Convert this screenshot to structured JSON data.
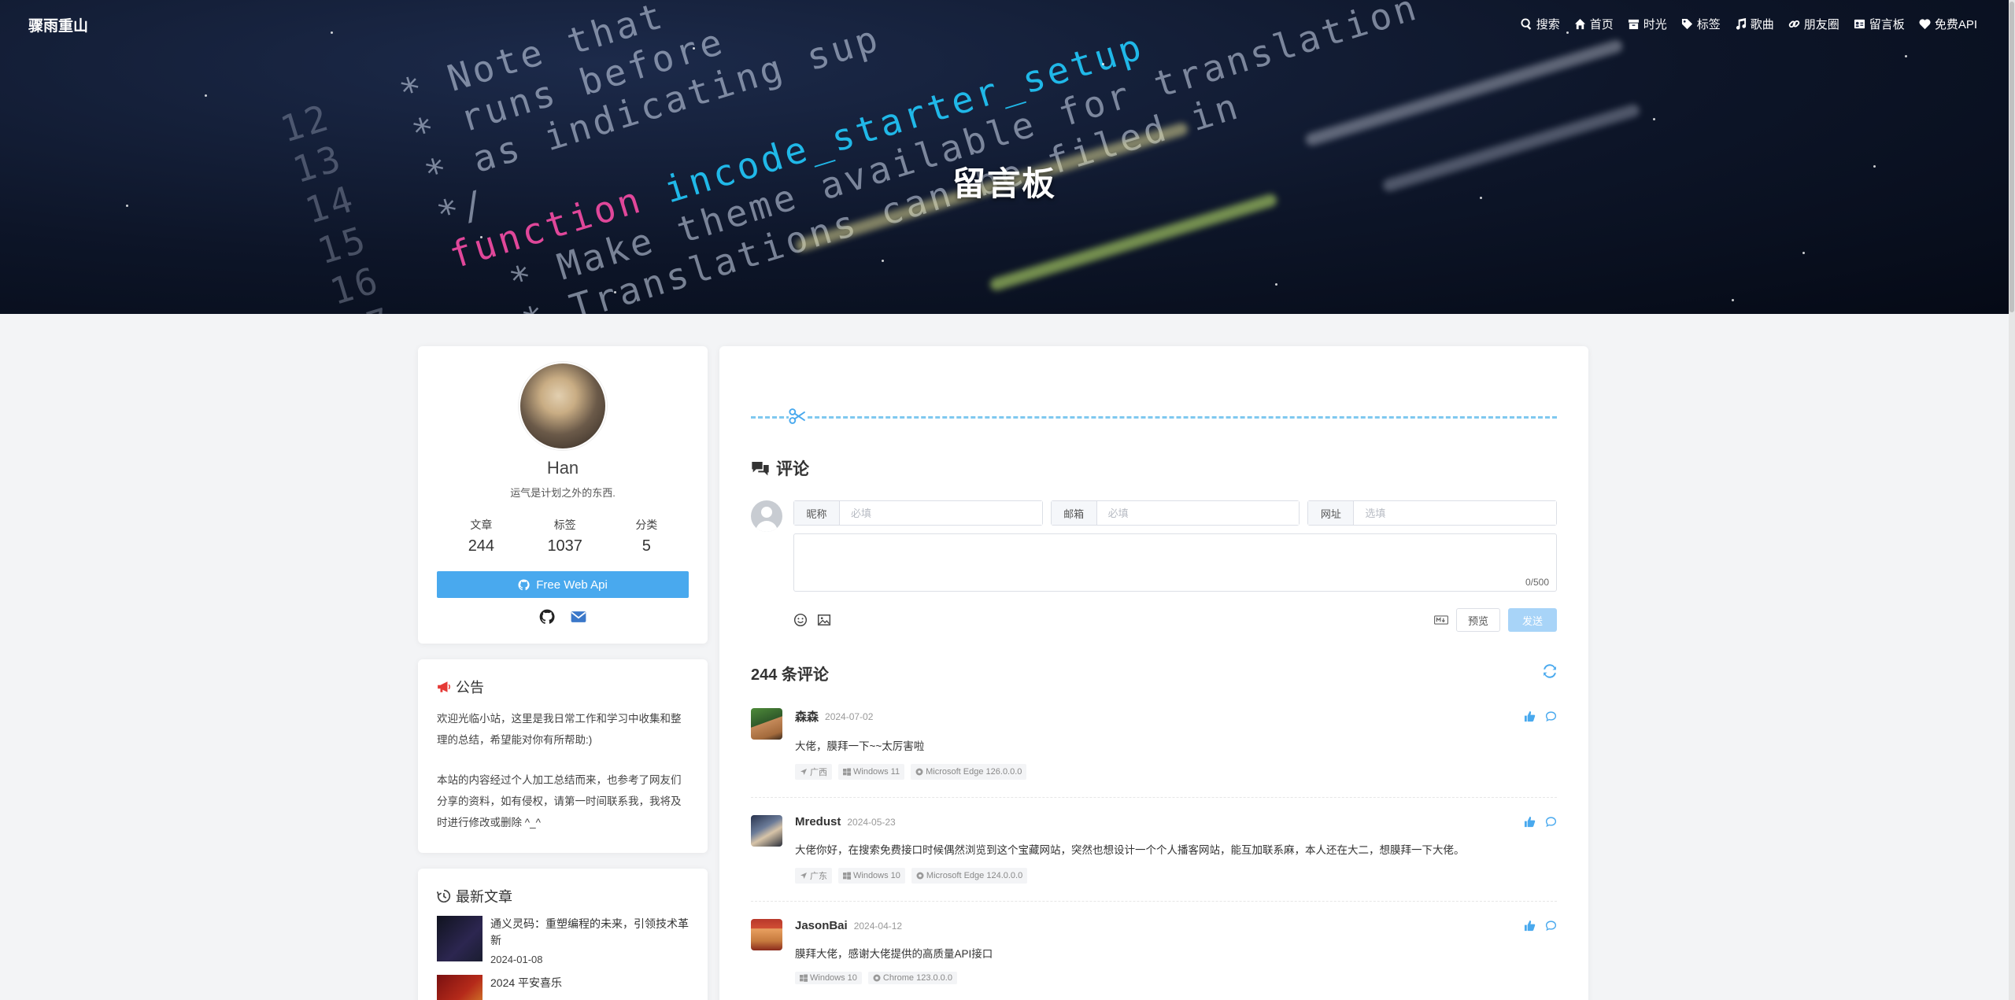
{
  "site": {
    "title": "骤雨重山"
  },
  "nav": [
    {
      "icon": "search-icon",
      "label": "搜索"
    },
    {
      "icon": "home-icon",
      "label": "首页"
    },
    {
      "icon": "archive-icon",
      "label": "时光"
    },
    {
      "icon": "tag-icon",
      "label": "标签"
    },
    {
      "icon": "music-icon",
      "label": "歌曲"
    },
    {
      "icon": "link-icon",
      "label": "朋友圈"
    },
    {
      "icon": "guestbook-icon",
      "label": "留言板"
    },
    {
      "icon": "heart-icon",
      "label": "免费API"
    }
  ],
  "hero": {
    "title": "留言板"
  },
  "profile": {
    "name": "Han",
    "motto": "运气是计划之外的东西.",
    "stats": [
      {
        "label": "文章",
        "value": "244"
      },
      {
        "label": "标签",
        "value": "1037"
      },
      {
        "label": "分类",
        "value": "5"
      }
    ],
    "button_label": "Free Web Api"
  },
  "notice": {
    "title": "公告",
    "paragraphs": [
      "欢迎光临小站，这里是我日常工作和学习中收集和整理的总结，希望能对你有所帮助:)",
      "本站的内容经过个人加工总结而来，也参考了网友们分享的资料，如有侵权，请第一时间联系我，我将及时进行修改或删除 ^_^"
    ]
  },
  "recent": {
    "title": "最新文章",
    "posts": [
      {
        "title": "通义灵码：重塑编程的未来，引领技术革新",
        "date": "2024-01-08"
      },
      {
        "title": "2024 平安喜乐",
        "date": ""
      }
    ]
  },
  "comment_form": {
    "heading": "评论",
    "nick_label": "昵称",
    "nick_placeholder": "必填",
    "mail_label": "邮箱",
    "mail_placeholder": "必填",
    "url_label": "网址",
    "url_placeholder": "选填",
    "counter": "0/500",
    "preview_label": "预览",
    "send_label": "发送"
  },
  "comments_count": "244 条评论",
  "comments": [
    {
      "user": "森森",
      "date": "2024-07-02",
      "text": "大佬，膜拜一下~~太厉害啦",
      "tags": [
        "广西",
        "Windows 11",
        "Microsoft Edge 126.0.0.0"
      ],
      "avatar_color": "#3d6b3a"
    },
    {
      "user": "Mredust",
      "date": "2024-05-23",
      "text": "大佬你好，在搜索免费接口时候偶然浏览到这个宝藏网站，突然也想设计一个个人播客网站，能互加联系麻，本人还在大二，想膜拜一下大佬。",
      "tags": [
        "广东",
        "Windows 10",
        "Microsoft Edge 124.0.0.0"
      ],
      "avatar_color": "#3a4a66"
    },
    {
      "user": "JasonBai",
      "date": "2024-04-12",
      "text": "膜拜大佬，感谢大佬提供的高质量API接口",
      "tags": [
        "Windows 10",
        "Chrome 123.0.0.0"
      ],
      "avatar_color": "#c0392b"
    }
  ],
  "colors": {
    "accent": "#49a9ee",
    "send_disabled": "#a8d4f8",
    "notice_icon": "#e53935"
  }
}
